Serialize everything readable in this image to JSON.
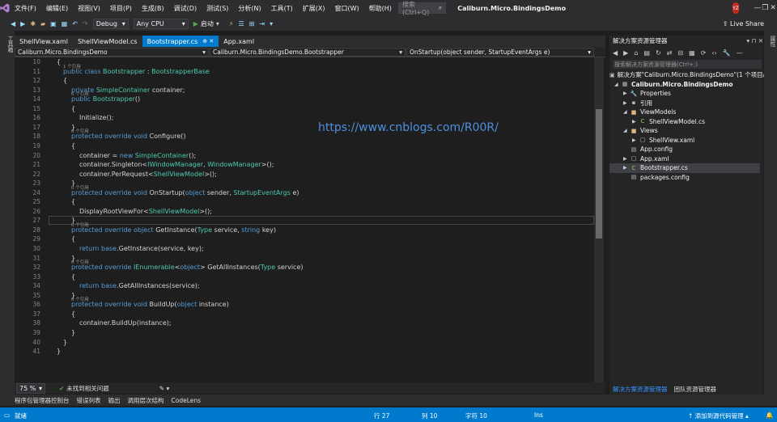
{
  "menubar": {
    "items": [
      "文件(F)",
      "编辑(E)",
      "视图(V)",
      "项目(P)",
      "生成(B)",
      "调试(D)",
      "测试(S)",
      "分析(N)",
      "工具(T)",
      "扩展(X)",
      "窗口(W)",
      "帮助(H)"
    ],
    "search_placeholder": "搜索 (Ctrl+Q)",
    "project_title": "Caliburn.Micro.BindingsDemo",
    "avatar_initials": "YZ"
  },
  "toolbar": {
    "config": "Debug",
    "platform": "Any CPU",
    "start_label": "启动",
    "live_share": "Live Share"
  },
  "left_strip": "工具箱",
  "right_strip": "属性",
  "tabs": [
    {
      "label": "ShellView.xaml",
      "active": false
    },
    {
      "label": "ShellViewModel.cs",
      "active": false
    },
    {
      "label": "Bootstrapper.cs",
      "active": true
    },
    {
      "label": "App.xaml",
      "active": false
    }
  ],
  "navbar": {
    "project": "Caliburn.Micro.BindingsDemo",
    "type": "Caliburn.Micro.BindingsDemo.Bootstrapper",
    "member": "OnStartup(object sender, StartupEventArgs e)"
  },
  "watermark": "https://www.cnblogs.com/R00R/",
  "code_lines": [
    {
      "n": "10",
      "t": "{",
      "ind": 0
    },
    {
      "n": "11",
      "t": "public class Bootstrapper : BootstrapperBase",
      "ind": 1,
      "ref": "1 个引用"
    },
    {
      "n": "12",
      "t": "{",
      "ind": 1
    },
    {
      "n": "13",
      "t": "private SimpleContainer container;",
      "ind": 2
    },
    {
      "n": "14",
      "t": "public Bootstrapper()",
      "ind": 2,
      "ref": "0 个引用"
    },
    {
      "n": "15",
      "t": "{",
      "ind": 2
    },
    {
      "n": "16",
      "t": "Initialize();",
      "ind": 3
    },
    {
      "n": "17",
      "t": "}",
      "ind": 2
    },
    {
      "n": "18",
      "t": "protected override void Configure()",
      "ind": 2,
      "ref": "0 个引用"
    },
    {
      "n": "19",
      "t": "{",
      "ind": 2
    },
    {
      "n": "20",
      "t": "container = new SimpleContainer();",
      "ind": 3
    },
    {
      "n": "21",
      "t": "container.Singleton<IWindowManager, WindowManager>();",
      "ind": 3
    },
    {
      "n": "22",
      "t": "container.PerRequest<ShellViewModel>();",
      "ind": 3
    },
    {
      "n": "23",
      "t": "}",
      "ind": 2
    },
    {
      "n": "24",
      "t": "protected override void OnStartup(object sender, StartupEventArgs e)",
      "ind": 2,
      "ref": "0 个引用"
    },
    {
      "n": "25",
      "t": "{",
      "ind": 2
    },
    {
      "n": "26",
      "t": "DisplayRootViewFor<ShellViewModel>();",
      "ind": 3
    },
    {
      "n": "27",
      "t": "}",
      "ind": 2
    },
    {
      "n": "28",
      "t": "protected override object GetInstance(Type service, string key)",
      "ind": 2,
      "ref": "0 个引用"
    },
    {
      "n": "29",
      "t": "{",
      "ind": 2
    },
    {
      "n": "30",
      "t": "return base.GetInstance(service, key);",
      "ind": 3
    },
    {
      "n": "31",
      "t": "}",
      "ind": 2
    },
    {
      "n": "32",
      "t": "protected override IEnumerable<object> GetAllInstances(Type service)",
      "ind": 2,
      "ref": "0 个引用"
    },
    {
      "n": "33",
      "t": "{",
      "ind": 2
    },
    {
      "n": "34",
      "t": "return base.GetAllInstances(service);",
      "ind": 3
    },
    {
      "n": "35",
      "t": "}",
      "ind": 2
    },
    {
      "n": "36",
      "t": "protected override void BuildUp(object instance)",
      "ind": 2,
      "ref": "0 个引用"
    },
    {
      "n": "37",
      "t": "{",
      "ind": 2
    },
    {
      "n": "38",
      "t": "container.BuildUp(instance);",
      "ind": 3
    },
    {
      "n": "39",
      "t": "}",
      "ind": 2
    },
    {
      "n": "40",
      "t": "}",
      "ind": 1
    },
    {
      "n": "41",
      "t": "}",
      "ind": 0
    }
  ],
  "editor_status": {
    "zoom": "75 %",
    "issues": "未找到相关问题"
  },
  "bottom_tabs": [
    "程序包管理器控制台",
    "错误列表",
    "输出",
    "调用层次结构",
    "CodeLens"
  ],
  "statusbar": {
    "ready": "就绪",
    "line": "行 27",
    "col": "列 10",
    "char": "字符 10",
    "mode": "Ins",
    "source_control": "↑ 添加到源代码管理 ▴"
  },
  "solution_explorer": {
    "title": "解决方案资源管理器",
    "search_placeholder": "搜索解决方案资源管理器(Ctrl+;)",
    "nodes": [
      {
        "label": "解决方案\"Caliburn.Micro.BindingsDemo\"(1 个项目/共 1 个)",
        "depth": 0,
        "arrow": "",
        "icon": "▣"
      },
      {
        "label": "Caliburn.Micro.BindingsDemo",
        "depth": 0,
        "arrow": "◢",
        "icon": "▦",
        "bold": true
      },
      {
        "label": "Properties",
        "depth": 1,
        "arrow": "▶",
        "icon": "🔧"
      },
      {
        "label": "引用",
        "depth": 1,
        "arrow": "▶",
        "icon": "▪"
      },
      {
        "label": "ViewModels",
        "depth": 1,
        "arrow": "◢",
        "icon": "■"
      },
      {
        "label": "ShellViewModel.cs",
        "depth": 2,
        "arrow": "▶",
        "icon": "C"
      },
      {
        "label": "Views",
        "depth": 1,
        "arrow": "◢",
        "icon": "■"
      },
      {
        "label": "ShellView.xaml",
        "depth": 2,
        "arrow": "▶",
        "icon": "▢"
      },
      {
        "label": "App.config",
        "depth": 1,
        "arrow": "",
        "icon": "▤"
      },
      {
        "label": "App.xaml",
        "depth": 1,
        "arrow": "▶",
        "icon": "▢"
      },
      {
        "label": "Bootstrapper.cs",
        "depth": 1,
        "arrow": "▶",
        "icon": "C",
        "selected": true
      },
      {
        "label": "packages.config",
        "depth": 1,
        "arrow": "",
        "icon": "▤"
      }
    ],
    "bottom_tabs": [
      "解决方案资源管理器",
      "团队资源管理器"
    ]
  },
  "colors": {
    "accent": "#007acc",
    "keyword": "#569cd6",
    "type": "#4ec9b0",
    "watermark": "#4d8fe0"
  }
}
